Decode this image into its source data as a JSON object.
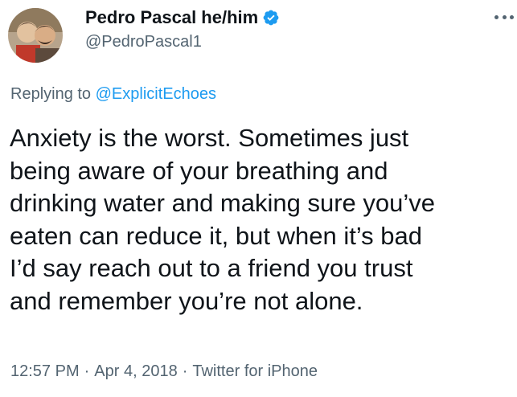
{
  "author": {
    "display_name": "Pedro Pascal he/him",
    "handle": "@PedroPascal1",
    "verified": true,
    "avatar_icon": "profile-photo"
  },
  "reply": {
    "prefix": "Replying to",
    "handle": "@ExplicitEchoes"
  },
  "body": {
    "lines": [
      "Anxiety is the worst. Sometimes just",
      "being aware of your breathing and",
      "drinking water and making sure you’ve",
      "eaten can reduce it, but when it’s bad",
      "I’d say reach out to a friend you trust",
      "and remember you’re not alone."
    ]
  },
  "meta": {
    "time": "12:57 PM",
    "separator": "·",
    "date": "Apr 4, 2018",
    "source": "Twitter for iPhone"
  },
  "colors": {
    "text": "#0f1419",
    "secondary": "#536471",
    "accent": "#1d9bf0",
    "background": "#ffffff"
  }
}
